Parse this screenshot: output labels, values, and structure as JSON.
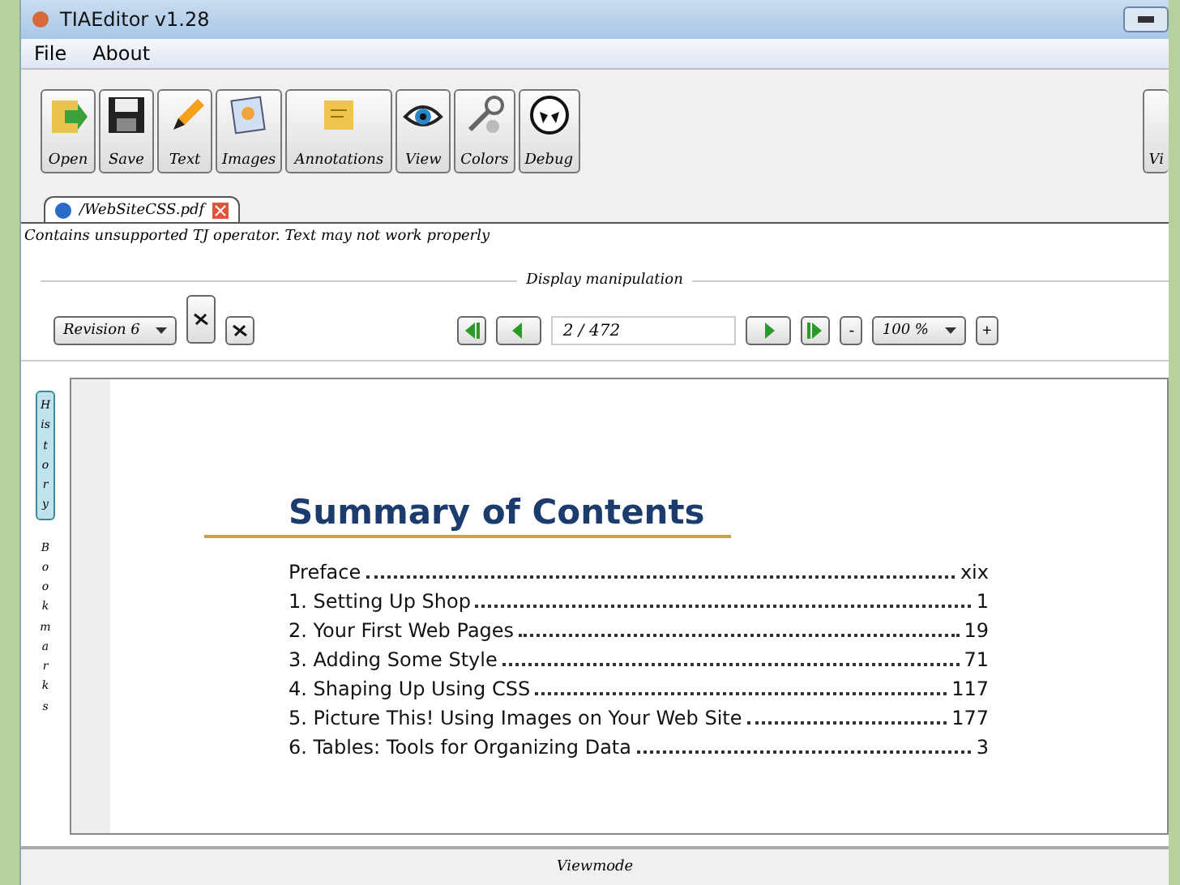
{
  "window": {
    "title": "TIAEditor v1.28"
  },
  "menu": [
    "File",
    "About"
  ],
  "toolbar": [
    {
      "label": "Open",
      "kind": "open"
    },
    {
      "label": "Save",
      "kind": "save"
    },
    {
      "label": "Text",
      "kind": "text"
    },
    {
      "label": "Images",
      "kind": "images"
    },
    {
      "label": "Annotations",
      "kind": "annotations"
    },
    {
      "label": "View",
      "kind": "view"
    },
    {
      "label": "Colors",
      "kind": "colors"
    },
    {
      "label": "Debug",
      "kind": "debug"
    }
  ],
  "toolbar_right": {
    "label": "Vi"
  },
  "document_tab": {
    "label": "/WebSiteCSS.pdf",
    "selected": true
  },
  "warning": "Contains unsupported TJ operator. Text may not work properly",
  "display_section": {
    "title": "Display manipulation",
    "revision": "Revision 6",
    "page": "2 / 472",
    "zoom": "100 %",
    "zoom_out": "-",
    "zoom_in": "+"
  },
  "side_tabs": [
    {
      "label": "History",
      "selected": true
    },
    {
      "label": "Bookmarks",
      "selected": false
    }
  ],
  "page": {
    "heading": "Summary of Contents",
    "entries": [
      {
        "title": "Preface",
        "page": "xix"
      },
      {
        "title": "1. Setting Up Shop",
        "page": "1"
      },
      {
        "title": "2. Your First Web Pages",
        "page": "19"
      },
      {
        "title": "3. Adding Some Style",
        "page": "71"
      },
      {
        "title": "4. Shaping Up Using CSS",
        "page": "117"
      },
      {
        "title": "5. Picture This! Using Images on Your Web Site",
        "page": "177"
      },
      {
        "title": "6. Tables: Tools for Organizing Data",
        "page": "3"
      }
    ]
  },
  "status_bar": "Viewmode"
}
